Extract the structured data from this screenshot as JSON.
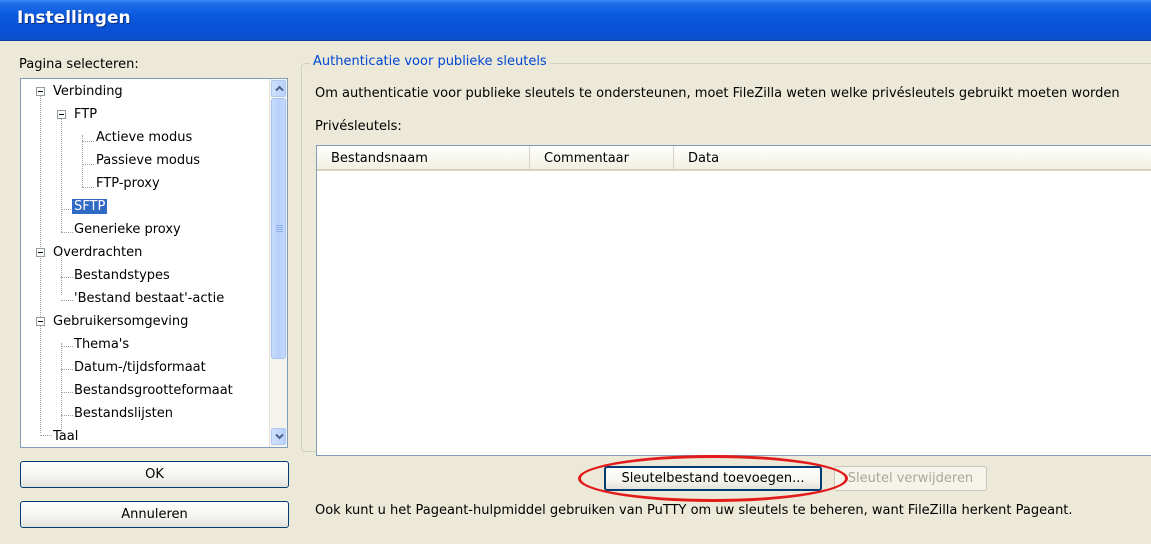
{
  "window": {
    "title": "Instellingen"
  },
  "left": {
    "page_label": "Pagina selecteren:",
    "tree": [
      {
        "label": "Verbinding",
        "level": 0,
        "expanded": true
      },
      {
        "label": "FTP",
        "level": 1,
        "expanded": true
      },
      {
        "label": "Actieve modus",
        "level": 2
      },
      {
        "label": "Passieve modus",
        "level": 2
      },
      {
        "label": "FTP-proxy",
        "level": 2
      },
      {
        "label": "SFTP",
        "level": 1,
        "selected": true
      },
      {
        "label": "Generieke proxy",
        "level": 1
      },
      {
        "label": "Overdrachten",
        "level": 0,
        "expanded": true
      },
      {
        "label": "Bestandstypes",
        "level": 1
      },
      {
        "label": "'Bestand bestaat'-actie",
        "level": 1
      },
      {
        "label": "Gebruikersomgeving",
        "level": 0,
        "expanded": true
      },
      {
        "label": "Thema's",
        "level": 1
      },
      {
        "label": "Datum-/tijdsformaat",
        "level": 1
      },
      {
        "label": "Bestandsgrootteformaat",
        "level": 1
      },
      {
        "label": "Bestandslijsten",
        "level": 1
      },
      {
        "label": "Taal",
        "level": 0
      }
    ],
    "ok_label": "OK",
    "cancel_label": "Annuleren"
  },
  "main": {
    "group_title": "Authenticatie voor publieke sleutels",
    "description": "Om authenticatie voor publieke sleutels te ondersteunen, moet FileZilla weten welke privésleutels gebruikt moeten worden",
    "keys_label": "Privésleutels:",
    "columns": [
      "Bestandsnaam",
      "Commentaar",
      "Data"
    ],
    "rows": [],
    "add_key_label": "Sleutelbestand toevoegen...",
    "remove_key_label": "Sleutel verwijderen",
    "footer_text": "Ook kunt u het Pageant-hulpmiddel gebruiken van PuTTY om uw sleutels te beheren, want FileZilla herkent Pageant."
  },
  "colors": {
    "titlebar": "#0a58dd",
    "selection": "#316ac5",
    "group_title": "#0046d5",
    "highlight": "#e21b1b"
  }
}
